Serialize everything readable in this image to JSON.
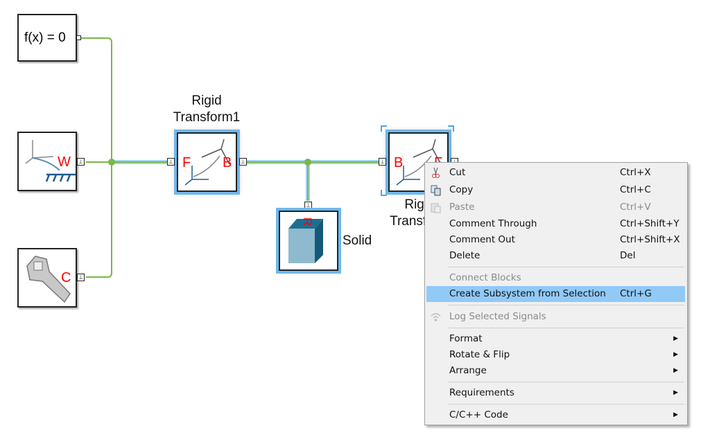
{
  "colors": {
    "connection": "#7ab648",
    "selection": "#6cb8ec",
    "port_label": "#ff0000",
    "menu_bg": "#f0f0f0",
    "menu_highlight": "#91c9f7"
  },
  "blocks": {
    "solver": {
      "text": "f(x) = 0"
    },
    "world": {
      "port": "W",
      "icon": "world-frame-icon"
    },
    "config": {
      "port": "C",
      "icon": "wrench-icon"
    },
    "rt1": {
      "title_line1": "Rigid",
      "title_line2": "Transform1",
      "port_left": "F",
      "port_right": "B",
      "icon": "rigid-transform-icon"
    },
    "solid": {
      "title": "Solid",
      "port": "R",
      "icon": "cube-icon"
    },
    "rt2": {
      "title_line1": "Rigid",
      "title_line2": "Transform",
      "port_left": "B",
      "port_right": "F",
      "icon": "rigid-transform-icon"
    }
  },
  "menu": {
    "items": [
      {
        "label": "Cut",
        "shortcut": "Ctrl+X",
        "icon": "scissors-icon"
      },
      {
        "label": "Copy",
        "shortcut": "Ctrl+C",
        "icon": "copy-icon"
      },
      {
        "label": "Paste",
        "shortcut": "Ctrl+V",
        "icon": "paste-icon",
        "disabled": true
      },
      {
        "label": "Comment Through",
        "shortcut": "Ctrl+Shift+Y"
      },
      {
        "label": "Comment Out",
        "shortcut": "Ctrl+Shift+X"
      },
      {
        "label": "Delete",
        "shortcut": "Del"
      },
      {
        "label": "Connect Blocks",
        "disabled": true
      },
      {
        "label": "Create Subsystem from Selection",
        "shortcut": "Ctrl+G",
        "highlighted": true
      },
      {
        "label": "Log Selected Signals",
        "icon": "signal-log-icon",
        "disabled": true
      },
      {
        "label": "Format",
        "submenu": true
      },
      {
        "label": "Rotate & Flip",
        "submenu": true
      },
      {
        "label": "Arrange",
        "submenu": true
      },
      {
        "label": "Requirements",
        "submenu": true
      },
      {
        "label": "C/C++ Code",
        "submenu": true
      }
    ]
  }
}
